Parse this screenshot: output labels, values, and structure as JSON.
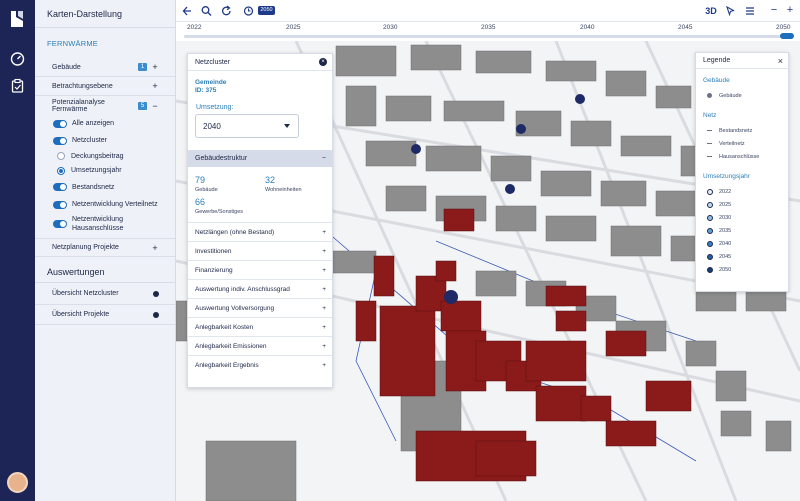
{
  "rail": {
    "icons": [
      "logo-icon",
      "dashboard-gauge-icon",
      "clipboard-icon"
    ]
  },
  "sidebar": {
    "title": "Karten-Darstellung",
    "section": "FERNWÄRME",
    "gebaeude": {
      "label": "Gebäude",
      "badge": "1"
    },
    "betrachtungsebene": "Betrachtungsebene",
    "potenzial": {
      "label": "Potenzialanalyse Fernwärme",
      "badge": "5"
    },
    "options": {
      "alle": "Alle anzeigen",
      "netzcluster": "Netzcluster",
      "deckungsbeitrag": "Deckungsbeitrag",
      "umsetzungsjahr": "Umsetzungsjahr",
      "bestandsnetz": "Bestandsnetz",
      "verteilnetz": "Netzentwicklung Verteilnetz",
      "hausanschluesse": "Netzentwicklung Hausanschlüsse"
    },
    "netzplanung": "Netzplanung Projekte",
    "auswertungen": "Auswertungen",
    "uebersicht_netzcluster": "Übersicht Netzcluster",
    "uebersicht_projekte": "Übersicht Projekte"
  },
  "toolbar": {
    "year": "2050",
    "mode3d": "3D"
  },
  "timeline": {
    "ticks": [
      "2022",
      "2025",
      "2030",
      "2035",
      "2040",
      "2045",
      "2050"
    ]
  },
  "panel": {
    "title": "Netzcluster",
    "gemeinde_label": "Gemeinde",
    "id_label": "ID: 375",
    "umsetzung_label": "Umsetzung:",
    "umsetzung_value": "2040",
    "gebaeudestruktur": "Gebäudestruktur",
    "stats": [
      {
        "n": "79",
        "t": "Gebäude"
      },
      {
        "n": "32",
        "t": "Wohneinheiten"
      },
      {
        "n": "66",
        "t": "Gewerbe/Sonstiges"
      }
    ],
    "sections": [
      "Netzlängen (ohne Bestand)",
      "Investitionen",
      "Finanzierung",
      "Auswertung indiv. Anschlussgrad",
      "Auswertung Vollversorgung",
      "Anlegbarkeit Kosten",
      "Anlegbarkeit Emissionen",
      "Anlegbarkeit Ergebnis"
    ]
  },
  "legend": {
    "title": "Legende",
    "gebaeude_section": "Gebäude",
    "gebaeude_item": "Gebäude",
    "netz_section": "Netz",
    "netz_items": [
      "Bestandsnetz",
      "Verteilnetz",
      "Hausanschlüsse"
    ],
    "jahr_section": "Umsetzungsjahr",
    "years": [
      "2022",
      "2025",
      "2030",
      "2035",
      "2040",
      "2045",
      "2050"
    ],
    "year_colors": [
      "#dfeefa",
      "#b9d7f0",
      "#8cbce3",
      "#5e9fd3",
      "#3a80c0",
      "#24609f",
      "#163f73"
    ]
  },
  "colors": {
    "rail": "#1c2556",
    "accent": "#1d6fbd",
    "building_gray": "#8c8c8c",
    "building_red": "#8b1a1a"
  }
}
